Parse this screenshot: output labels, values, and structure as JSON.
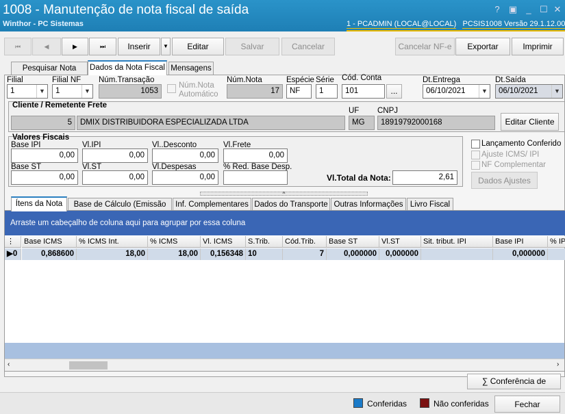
{
  "window": {
    "title": "1008 - Manutenção de nota fiscal de saída",
    "subtitle": "Winthor - PC Sistemas",
    "status_user": "1 - PCADMIN (LOCAL@LOCAL)",
    "status_version": "PCSIS1008  Versão  29.1.12.003",
    "help_glyph": "?",
    "min_glyph": "_",
    "max_glyph": "☐",
    "close_glyph": "✕"
  },
  "toolbar": {
    "first": "⏮",
    "prev": "◀",
    "next": "▶",
    "last": "⏭",
    "insert": "Inserir",
    "edit": "Editar",
    "save": "Salvar",
    "cancel": "Cancelar",
    "cancel_nfe": "Cancelar NF-e",
    "export": "Exportar",
    "print": "Imprimir"
  },
  "main_tabs": [
    "Pesquisar Nota Fiscal",
    "Dados da Nota Fiscal",
    "Mensagens"
  ],
  "form": {
    "filial_label": "Filial",
    "filial_value": "1",
    "filial_nf_label": "Filial NF",
    "filial_nf_value": "1",
    "num_transacao_label": "Núm.Transação",
    "num_transacao_value": "1053",
    "num_nota_auto_label": "Núm.Nota Automático",
    "num_nota_label": "Núm.Nota",
    "num_nota_value": "17",
    "especie_label": "Espécie",
    "especie_value": "NF",
    "serie_label": "Série",
    "serie_value": "1",
    "cod_conta_label": "Cód. Conta",
    "cod_conta_value": "101",
    "ellipsis": "...",
    "dt_entrega_label": "Dt.Entrega",
    "dt_entrega_value": "06/10/2021",
    "dt_saida_label": "Dt.Saída",
    "dt_saida_value": "06/10/2021"
  },
  "cliente": {
    "section_label": "Cliente / Remetente Frete",
    "code": "5",
    "name": "DMIX DISTRIBUIDORA ESPECIALIZADA LTDA",
    "uf_label": "UF",
    "uf_value": "MG",
    "cnpj_label": "CNPJ",
    "cnpj_value": "18919792000168",
    "edit_button": "Editar Cliente"
  },
  "valores": {
    "section_label": "Valores Fiscais",
    "base_ipi_label": "Base IPI",
    "base_ipi": "0,00",
    "vl_ipi_label": "Vl.IPI",
    "vl_ipi": "0,00",
    "vl_desconto_label": "Vl..Desconto",
    "vl_desconto": "0,00",
    "vl_frete_label": "Vl.Frete",
    "vl_frete": "0,00",
    "base_st_label": "Base ST",
    "base_st": "0,00",
    "vl_st_label": "Vl.ST",
    "vl_st": "0,00",
    "vl_despesas_label": "Vl.Despesas",
    "vl_despesas": "0,00",
    "red_base_label": "% Red. Base Desp.",
    "red_base": "",
    "total_label": "Vl.Total da Nota:",
    "total": "2,61"
  },
  "options": {
    "lancamento": "Lançamento Conferido",
    "ajuste": "Ajuste ICMS/ IPI",
    "nf_complementar": "NF Complementar",
    "dados_ajustes": "Dados Ajustes"
  },
  "sub_tabs": [
    "Ítens da Nota",
    "Base de Cálculo (Emissão NF)",
    "Inf. Complementares",
    "Dados do Transporte",
    "Outras Informações",
    "Livro Fiscal"
  ],
  "grid": {
    "group_hint": "Arraste um cabeçalho de coluna aqui para agrupar por essa coluna",
    "columns": [
      "Base ICMS",
      "% ICMS Int.",
      "% ICMS",
      "Vl. ICMS",
      "S.Trib.",
      "Cód.Trib.",
      "Base ST",
      "Vl.ST",
      "Sit. tribut. IPI",
      "Base IPI",
      "% IPI"
    ],
    "row": {
      "indicator": "▶0",
      "cells": [
        "0,868600",
        "18,00",
        "18,00",
        "0,156348",
        "10",
        "7",
        "0,000000",
        "0,000000",
        "",
        "0,000000",
        ""
      ]
    }
  },
  "footer": {
    "conferencia": "Conferência de Valores",
    "sigma": "∑",
    "legend_conferidas": "Conferidas",
    "legend_nao": "Não conferidas",
    "fechar": "Fechar",
    "color_conferidas": "#1a7ac8",
    "color_nao": "#7a1010"
  }
}
